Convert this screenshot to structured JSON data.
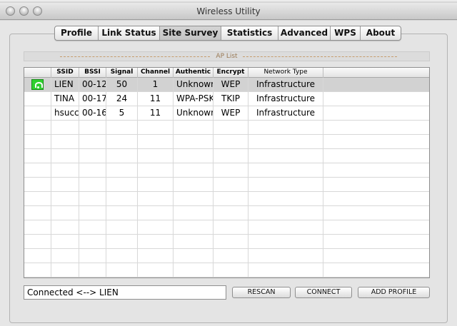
{
  "window": {
    "title": "Wireless Utility"
  },
  "tabs": [
    {
      "label": "Profile",
      "active": false
    },
    {
      "label": "Link Status",
      "active": false
    },
    {
      "label": "Site Survey",
      "active": true
    },
    {
      "label": "Statistics",
      "active": false
    },
    {
      "label": "Advanced",
      "active": false
    },
    {
      "label": "WPS",
      "active": false
    },
    {
      "label": "About",
      "active": false
    }
  ],
  "ap_list": {
    "title": "AP List",
    "columns": [
      "",
      "SSID",
      "BSSI",
      "Signal",
      "Channel",
      "Authentic",
      "Encrypt",
      "Network Type"
    ],
    "rows": [
      {
        "icon": "connected-network-icon",
        "ssid": "LIEN",
        "bssid": "00-12",
        "signal": "50",
        "channel": "1",
        "auth": "Unknowr",
        "encrypt": "WEP",
        "type": "Infrastructure",
        "selected": true
      },
      {
        "icon": "",
        "ssid": "TINA",
        "bssid": "00-17",
        "signal": "24",
        "channel": "11",
        "auth": "WPA-PSK",
        "encrypt": "TKIP",
        "type": "Infrastructure",
        "selected": false
      },
      {
        "icon": "",
        "ssid": "hsucc",
        "bssid": "00-16",
        "signal": "5",
        "channel": "11",
        "auth": "Unknowr",
        "encrypt": "WEP",
        "type": "Infrastructure",
        "selected": false
      }
    ]
  },
  "status": {
    "text": "Connected <--> LIEN"
  },
  "buttons": {
    "rescan": "RESCAN",
    "connect": "CONNECT",
    "add_profile": "ADD PROFILE"
  },
  "colors": {
    "accent_icon": "#2fd02f",
    "selected_row": "#d2d2d2",
    "ap_title": "#9a7a55"
  }
}
